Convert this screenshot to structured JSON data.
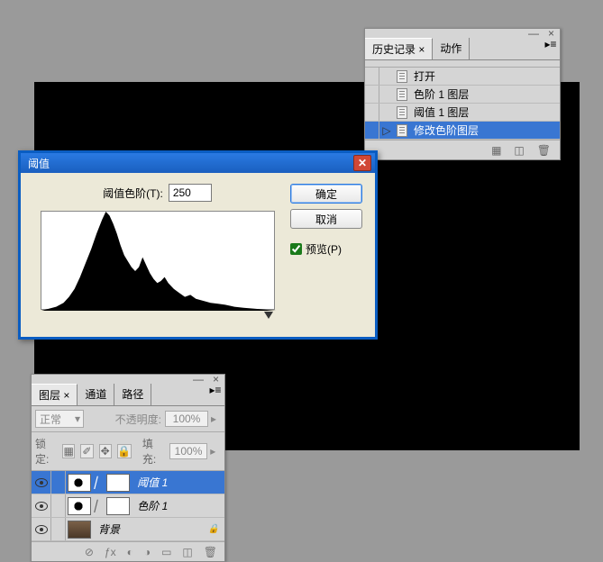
{
  "history": {
    "tabs": {
      "history": "历史记录",
      "actions": "动作"
    },
    "items": [
      {
        "label": "打开"
      },
      {
        "label": "色阶 1 图层"
      },
      {
        "label": "阈值 1 图层"
      },
      {
        "label": "修改色阶图层",
        "selected": true
      }
    ]
  },
  "dialog": {
    "title": "阈值",
    "field_label": "阈值色阶(T):",
    "value": "250",
    "ok": "确定",
    "cancel": "取消",
    "preview": "预览(P)"
  },
  "layers": {
    "tabs": {
      "layers": "图层",
      "channels": "通道",
      "paths": "路径"
    },
    "blend": "正常",
    "opacity_label": "不透明度:",
    "opacity": "100%",
    "lock_label": "锁定:",
    "fill_label": "填充:",
    "fill": "100%",
    "items": [
      {
        "name": "阈值 1",
        "type": "adj-threshold",
        "selected": true
      },
      {
        "name": "色阶 1",
        "type": "adj-levels"
      },
      {
        "name": "背景",
        "type": "bg",
        "locked": true
      }
    ]
  },
  "chart_data": {
    "type": "area",
    "title": "",
    "xlabel": "",
    "ylabel": "",
    "xlim": [
      0,
      255
    ],
    "ylim": [
      0,
      100
    ],
    "x": [
      0,
      8,
      16,
      24,
      30,
      36,
      42,
      48,
      54,
      60,
      66,
      70,
      74,
      78,
      82,
      86,
      90,
      94,
      98,
      102,
      106,
      110,
      114,
      118,
      122,
      126,
      130,
      134,
      138,
      144,
      150,
      156,
      162,
      168,
      176,
      184,
      192,
      200,
      210,
      220,
      232,
      244,
      255
    ],
    "values": [
      0,
      2,
      4,
      8,
      14,
      22,
      34,
      48,
      62,
      78,
      92,
      100,
      96,
      88,
      78,
      66,
      56,
      50,
      44,
      40,
      44,
      54,
      46,
      38,
      32,
      28,
      30,
      34,
      28,
      22,
      18,
      14,
      16,
      12,
      10,
      8,
      7,
      6,
      4,
      3,
      2,
      1,
      0
    ]
  }
}
